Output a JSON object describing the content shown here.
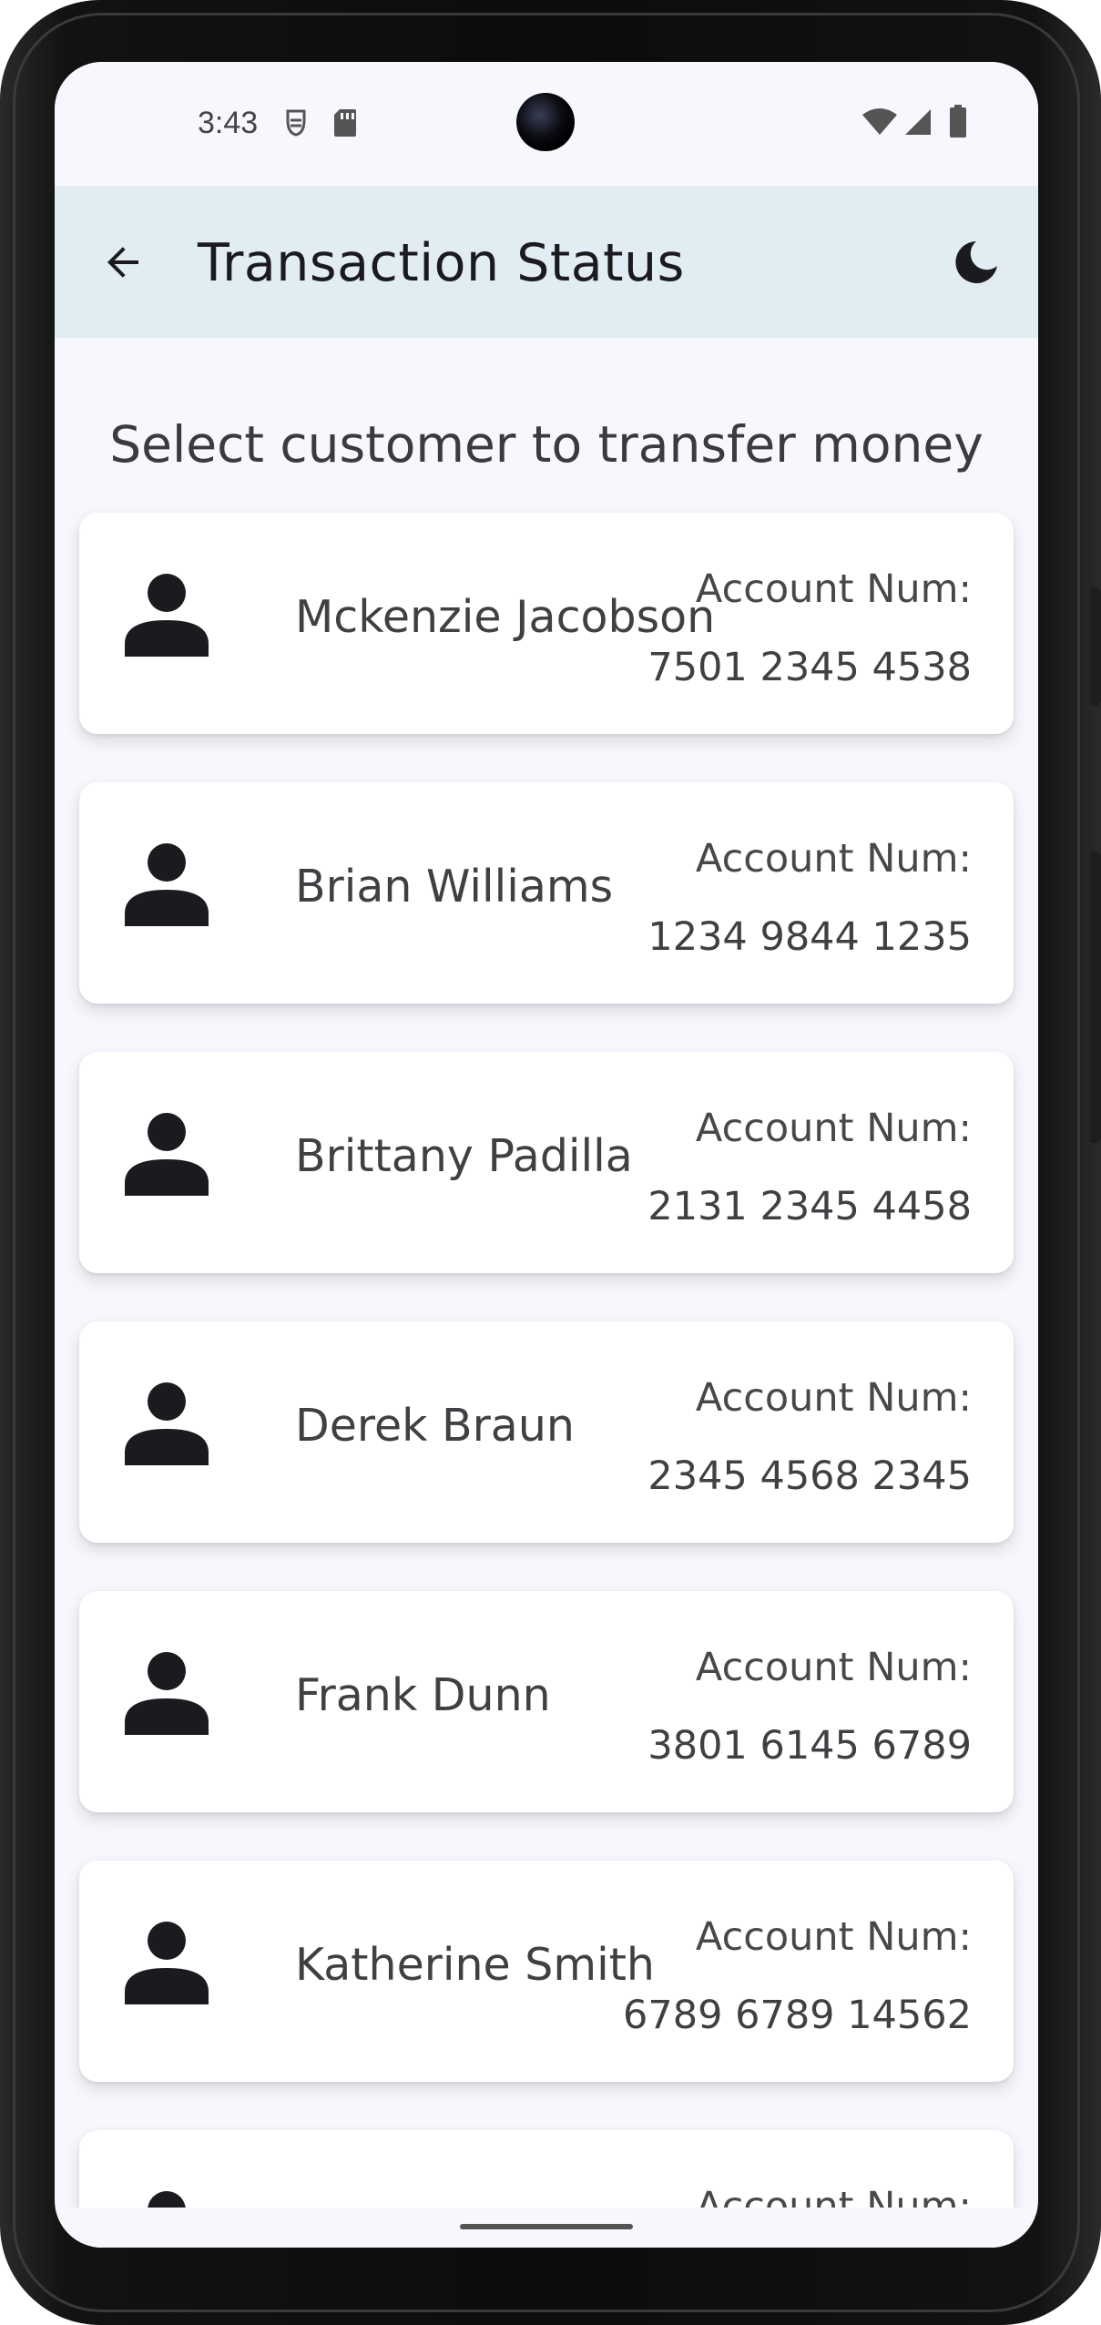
{
  "status_bar": {
    "time": "3:43",
    "icons_left": [
      "debug-icon",
      "sd-card-icon"
    ],
    "icons_right": [
      "wifi-icon",
      "cell-signal-icon",
      "battery-icon"
    ]
  },
  "app_bar": {
    "title": "Transaction Status",
    "back_icon": "arrow-back-icon",
    "theme_icon": "moon-icon",
    "background": "#e2ecf3"
  },
  "heading": "Select customer to transfer money",
  "customers": [
    {
      "name": "Mckenzie Jacobson",
      "account_label": "Account Num:",
      "account_number": "7501 2345 4538"
    },
    {
      "name": "Brian Williams",
      "account_label": "Account Num:",
      "account_number": "1234 9844 1235"
    },
    {
      "name": "Brittany Padilla",
      "account_label": "Account Num:",
      "account_number": "2131 2345 4458"
    },
    {
      "name": "Derek Braun",
      "account_label": "Account Num:",
      "account_number": "2345 4568 2345"
    },
    {
      "name": "Frank Dunn",
      "account_label": "Account Num:",
      "account_number": "3801 6145 6789"
    },
    {
      "name": "Katherine Smith",
      "account_label": "Account Num:",
      "account_number": "6789 6789 14562"
    },
    {
      "name": "",
      "account_label": "Account Num:",
      "account_number": ""
    }
  ],
  "colors": {
    "screen_background": "#f7f8fd",
    "card_background": "#ffffff",
    "icon_color": "#1b1b1f"
  }
}
